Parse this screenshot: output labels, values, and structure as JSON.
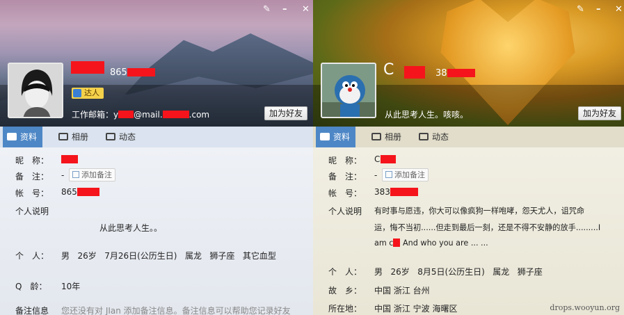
{
  "left": {
    "phone_prefix": "865",
    "badge": "达人",
    "email_label": "工作邮箱：",
    "email_user": "y",
    "email_domain": "@mail.",
    "email_tld": ".com",
    "add_friend": "加为好友",
    "tabs": [
      "资料",
      "相册",
      "动态"
    ],
    "fields": {
      "nickname_label": "昵　称：",
      "remark_label": "备　注：",
      "remark_dash": "-",
      "add_remark": "添加备注",
      "account_label": "帐　号：",
      "account_prefix": "865",
      "bio_label": "个人说明",
      "bio": "从此思考人生。。",
      "personal_label": "个　人：",
      "gender": "男",
      "age": "26岁",
      "birthday": "7月26日(公历生日)",
      "zodiac": "属龙",
      "star": "狮子座",
      "blood": "其它血型",
      "qage_label": "Q　龄：",
      "qage": "10年",
      "remark_info_label": "备注信息",
      "remark_info": "您还没有对 JIan 添加备注信息。备注信息可以帮助您记录好友"
    }
  },
  "right": {
    "name_initial": "C",
    "phone_prefix": "38",
    "signature": "从此思考人生。咳咳。",
    "add_friend": "加为好友",
    "tabs": [
      "资料",
      "相册",
      "动态"
    ],
    "fields": {
      "nickname_label": "昵　称：",
      "nickname_initial": "C",
      "remark_label": "备　注：",
      "remark_dash": "-",
      "add_remark": "添加备注",
      "account_label": "帐　号：",
      "account_prefix": "383",
      "bio_label": "个人说明",
      "bio_line1": "有时事与愿违，你大可以像疯狗一样咆哮，怨天尤人，诅咒命",
      "bio_line2": "运，悔不当初......但走到最后一刻，还是不得不安静的放手.........I",
      "bio_line3a": "am c",
      "bio_line3b": " And who you are ... ...",
      "personal_label": "个　人：",
      "gender": "男",
      "age": "26岁",
      "birthday": "8月5日(公历生日)",
      "zodiac": "属龙",
      "star": "狮子座",
      "hometown_label": "故　乡：",
      "hometown": "中国 浙江 台州",
      "location_label": "所在地：",
      "location": "中国 浙江 宁波 海曙区"
    }
  },
  "watermark": "drops.wooyun.org",
  "colors": {
    "redaction": "#f5141b",
    "tab_selected": "#4e87c6"
  },
  "icons": [
    "pen-icon",
    "minimize-icon",
    "close-icon",
    "profile-card-icon",
    "album-icon",
    "feed-icon",
    "note-icon"
  ]
}
